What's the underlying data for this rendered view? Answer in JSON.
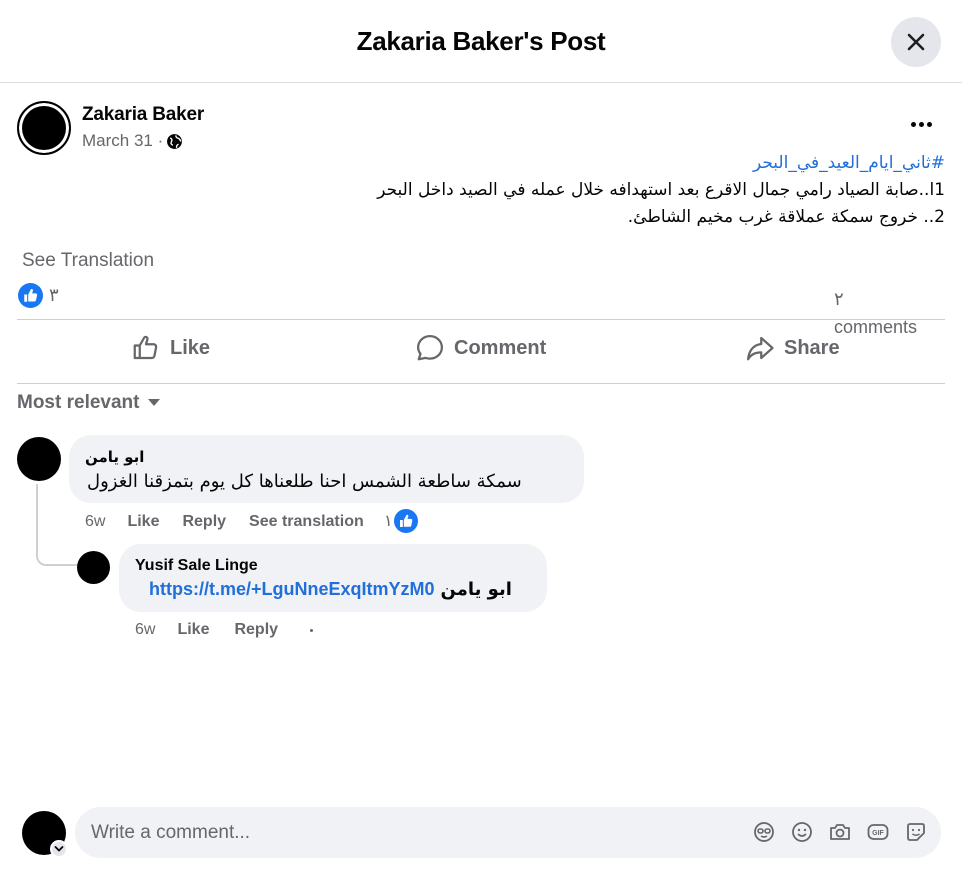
{
  "header": {
    "title": "Zakaria Baker's Post"
  },
  "post": {
    "author": "Zakaria Baker",
    "date": "March 31 ·",
    "hashtag": "#ثاني_ايام_العيد_في_البحر",
    "line1": "1ا..صابة الصياد رامي جمال الاقرع بعد استهدافه خلال عمله في الصيد داخل البحر",
    "line2": "2.. خروج سمكة عملاقة غرب مخيم الشاطئ.",
    "see_translation": "See Translation",
    "reaction_count": "٣",
    "comments_number": "٢",
    "comments_label": "comments"
  },
  "actions": {
    "like": "Like",
    "comment": "Comment",
    "share": "Share"
  },
  "sort": {
    "label": "Most relevant"
  },
  "comments": [
    {
      "author": "ابو يامن",
      "text": "سمكة ساطعة الشمس احنا طلعناها كل يوم بتمزقنا الغزول",
      "time": "6w",
      "like": "Like",
      "reply": "Reply",
      "see_translation": "See translation",
      "reactions": "١"
    }
  ],
  "reply": {
    "author": "Yusif Sale Linge",
    "mention": "ابو يامن",
    "link": "https://t.me/+LguNneExqItmYzM0",
    "time": "6w",
    "like": "Like",
    "reply": "Reply"
  },
  "composer": {
    "placeholder": "Write a comment..."
  },
  "icons": {
    "close": "close-icon",
    "globe": "globe-icon",
    "more": "more-icon",
    "like_reaction": "like-reaction-icon",
    "composer": [
      "avatar-sticker-icon",
      "emoji-icon",
      "camera-icon",
      "gif-icon",
      "sticker-icon"
    ]
  },
  "colors": {
    "link": "#216fdb",
    "like_blue": "#1877f2",
    "secondary_text": "#65676b",
    "bubble": "#f0f2f5"
  }
}
